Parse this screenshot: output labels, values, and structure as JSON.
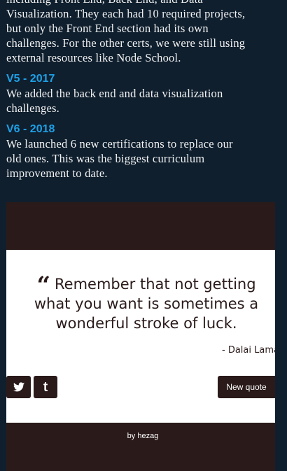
{
  "article": {
    "intro_lines": [
      "including Front End, Back End, and Data",
      "Visualization. They each had 10 required projects,",
      "but only the Front End section had its own",
      "challenges. For the other certs, we were still using",
      "external resources like Node School."
    ],
    "v5_heading": "V5 - 2017",
    "v5_lines": [
      "We added the back end and data visualization",
      "challenges."
    ],
    "v6_heading": "V6 - 2018",
    "v6_lines": [
      "We launched 6 new certifications to replace our",
      "old ones. This was the biggest curriculum",
      "improvement to date."
    ]
  },
  "quote_machine": {
    "quote_lines": [
      "Remember that not getting",
      "what you want is sometimes a",
      "wonderful stroke of luck."
    ],
    "quote_mark": "“",
    "author": "- Dalai Lama",
    "twitter_icon": "twitter-icon",
    "tumblr_icon": "tumblr-icon",
    "tumblr_glyph": "t",
    "new_quote_label": "New quote",
    "credit": "by hezag"
  },
  "colors": {
    "page_background": "#0f1f2e",
    "heading": "#1ea0e6",
    "embed_background": "#2a1a1a",
    "quote_box": "#ffffff"
  }
}
